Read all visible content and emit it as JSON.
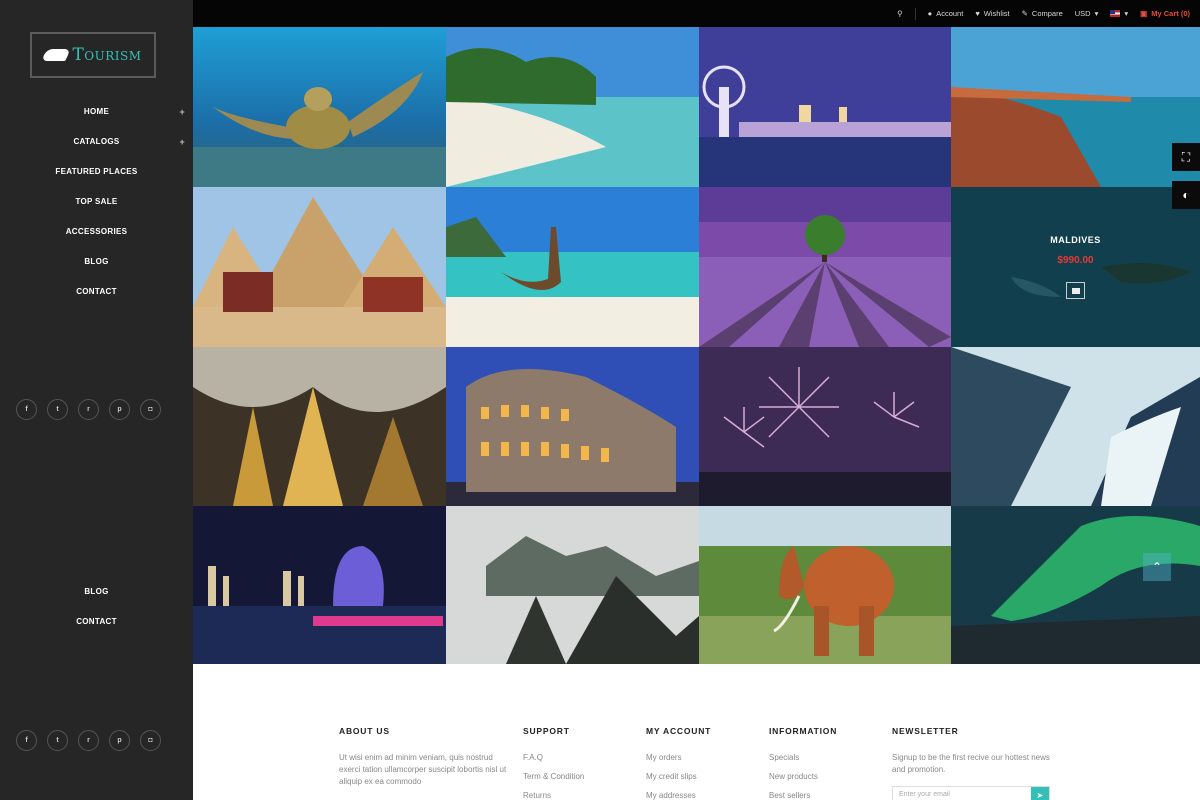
{
  "brand": {
    "logo_initial": "T",
    "logo_rest": "OURISM"
  },
  "sidebar": {
    "menu": [
      {
        "label": "HOME",
        "has_children": true
      },
      {
        "label": "CATALOGS",
        "has_children": true
      },
      {
        "label": "FEATURED PLACES",
        "has_children": false
      },
      {
        "label": "TOP SALE",
        "has_children": false
      },
      {
        "label": "ACCESSORIES",
        "has_children": false
      },
      {
        "label": "BLOG",
        "has_children": false
      },
      {
        "label": "CONTACT",
        "has_children": false
      }
    ],
    "menu_bottom": [
      {
        "label": "BLOG"
      },
      {
        "label": "CONTACT"
      }
    ],
    "social": [
      {
        "icon": "facebook-icon",
        "glyph": "f"
      },
      {
        "icon": "twitter-icon",
        "glyph": "t"
      },
      {
        "icon": "rss-icon",
        "glyph": "r"
      },
      {
        "icon": "pinterest-icon",
        "glyph": "p"
      },
      {
        "icon": "instagram-icon",
        "glyph": "◘"
      }
    ]
  },
  "topbar": {
    "account": "Account",
    "wishlist": "Wishlist",
    "compare": "Compare",
    "currency": "USD",
    "cart": "My Cart (0)"
  },
  "gallery": {
    "featured": {
      "title": "MALDIVES",
      "price": "$990.00"
    }
  },
  "footer": {
    "about": {
      "heading": "ABOUT US",
      "text": "Ut wisi enim ad minim veniam, quis nostrud exerci tation ullamcorper suscipit lobortis nisl ut aliquip ex ea commodo"
    },
    "support": {
      "heading": "SUPPORT",
      "links": [
        "F.A.Q",
        "Term & Condition",
        "Returns"
      ]
    },
    "account": {
      "heading": "MY ACCOUNT",
      "links": [
        "My orders",
        "My credit slips",
        "My addresses"
      ]
    },
    "information": {
      "heading": "INFORMATION",
      "links": [
        "Specials",
        "New products",
        "Best sellers"
      ]
    },
    "newsletter": {
      "heading": "NEWSLETTER",
      "text": "Signup to be the first recive our hottest news and promotion.",
      "placeholder": "Enter your email"
    }
  },
  "colors": {
    "accent": "#34c0b6",
    "sidebar": "#262626",
    "price": "#e53935",
    "cart": "#e74c3c"
  }
}
